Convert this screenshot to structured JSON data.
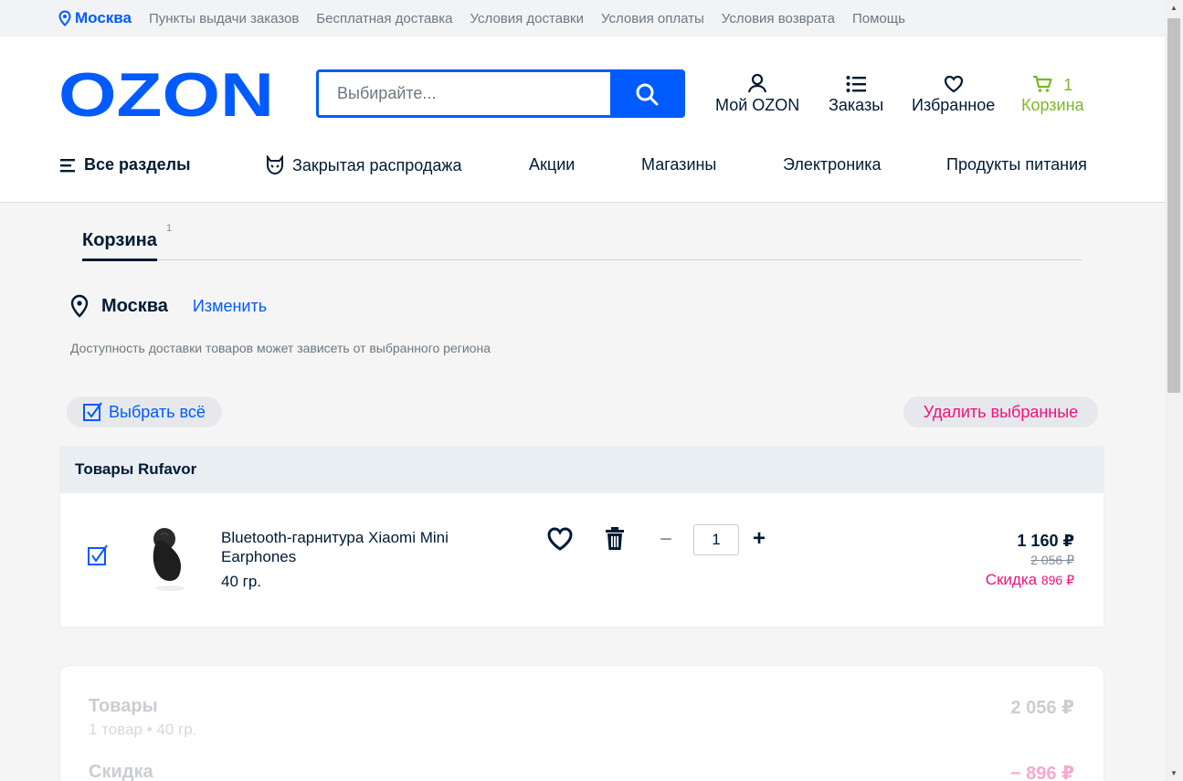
{
  "topbar": {
    "city": "Москва",
    "links": [
      "Пункты выдачи заказов",
      "Бесплатная доставка",
      "Условия доставки",
      "Условия оплаты",
      "Условия возврата",
      "Помощь"
    ]
  },
  "header": {
    "logo_text": "OZON",
    "search_placeholder": "Выбирайте...",
    "my_ozon": "Мой OZON",
    "orders": "Заказы",
    "favorites": "Избранное",
    "cart_label": "Корзина",
    "cart_count": "1"
  },
  "nav": {
    "all_sections": "Все разделы",
    "items": [
      "Закрытая распродажа",
      "Акции",
      "Магазины",
      "Электроника",
      "Продукты питания"
    ]
  },
  "cart": {
    "tab_label": "Корзина",
    "tab_count": "1",
    "region_name": "Москва",
    "region_change": "Изменить",
    "region_note": "Доступность доставки товаров может зависеть от выбранного региона",
    "select_all": "Выбрать всё",
    "delete_selected": "Удалить выбранные",
    "seller": "Товары Rufavor",
    "product": {
      "title": "Bluetooth-гарнитура Xiaomi Mini Earphones",
      "weight": "40 гр.",
      "quantity": "1",
      "minus": "−",
      "plus": "+",
      "price": "1 160 ₽",
      "old_price": "2 056 ₽",
      "discount_label": "Скидка",
      "discount_value": "896 ₽"
    }
  },
  "summary": {
    "goods_label": "Товары",
    "goods_sub": "1 товар • 40 гр.",
    "goods_value": "2 056 ₽",
    "discount_label": "Скидка",
    "discount_value": "− 896 ₽"
  },
  "colors": {
    "brand": "#005bff",
    "cart_green": "#7bb829",
    "discount_pink": "#f1117e"
  }
}
